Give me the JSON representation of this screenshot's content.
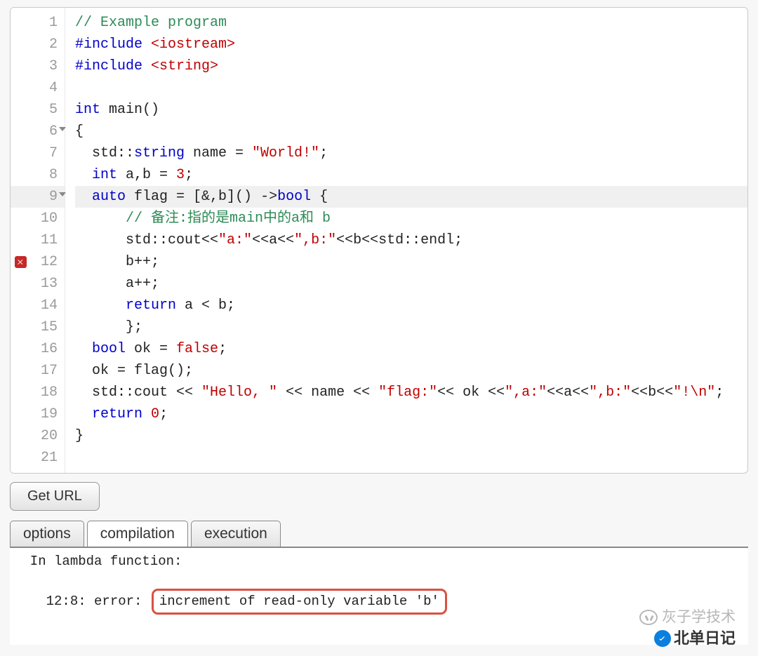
{
  "editor": {
    "error_line": 12,
    "fold_lines": [
      6,
      9
    ],
    "highlight_line": 9,
    "lines": [
      {
        "n": 1,
        "tokens": [
          {
            "t": "// Example program",
            "c": "comment"
          }
        ]
      },
      {
        "n": 2,
        "tokens": [
          {
            "t": "#include ",
            "c": "pp"
          },
          {
            "t": "<iostream>",
            "c": "inc"
          }
        ]
      },
      {
        "n": 3,
        "tokens": [
          {
            "t": "#include ",
            "c": "pp"
          },
          {
            "t": "<string>",
            "c": "inc"
          }
        ]
      },
      {
        "n": 4,
        "tokens": []
      },
      {
        "n": 5,
        "tokens": [
          {
            "t": "int",
            "c": "kwtype"
          },
          {
            "t": " main()",
            "c": "default"
          }
        ]
      },
      {
        "n": 6,
        "tokens": [
          {
            "t": "{",
            "c": "default"
          }
        ]
      },
      {
        "n": 7,
        "tokens": [
          {
            "t": "  std::",
            "c": "default"
          },
          {
            "t": "string",
            "c": "kwtype"
          },
          {
            "t": " name = ",
            "c": "default"
          },
          {
            "t": "\"World!\"",
            "c": "str"
          },
          {
            "t": ";",
            "c": "default"
          }
        ]
      },
      {
        "n": 8,
        "tokens": [
          {
            "t": "  ",
            "c": "default"
          },
          {
            "t": "int",
            "c": "kwtype"
          },
          {
            "t": " a,b = ",
            "c": "default"
          },
          {
            "t": "3",
            "c": "num"
          },
          {
            "t": ";",
            "c": "default"
          }
        ]
      },
      {
        "n": 9,
        "tokens": [
          {
            "t": "  ",
            "c": "default"
          },
          {
            "t": "auto",
            "c": "kwtype"
          },
          {
            "t": " flag = [&,b]() ->",
            "c": "default"
          },
          {
            "t": "bool",
            "c": "kwtype"
          },
          {
            "t": " {",
            "c": "default"
          }
        ]
      },
      {
        "n": 10,
        "tokens": [
          {
            "t": "      // 备注:指的是main中的a和 b",
            "c": "comment"
          }
        ]
      },
      {
        "n": 11,
        "tokens": [
          {
            "t": "      std::cout<<",
            "c": "default"
          },
          {
            "t": "\"a:\"",
            "c": "str"
          },
          {
            "t": "<<a<<",
            "c": "default"
          },
          {
            "t": "\",b:\"",
            "c": "str"
          },
          {
            "t": "<<b<<std::endl;",
            "c": "default"
          }
        ]
      },
      {
        "n": 12,
        "tokens": [
          {
            "t": "      b++;",
            "c": "default"
          }
        ]
      },
      {
        "n": 13,
        "tokens": [
          {
            "t": "      a++;",
            "c": "default"
          }
        ]
      },
      {
        "n": 14,
        "tokens": [
          {
            "t": "      ",
            "c": "default"
          },
          {
            "t": "return",
            "c": "kw"
          },
          {
            "t": " a < b;",
            "c": "default"
          }
        ]
      },
      {
        "n": 15,
        "tokens": [
          {
            "t": "      };",
            "c": "default"
          }
        ]
      },
      {
        "n": 16,
        "tokens": [
          {
            "t": "  ",
            "c": "default"
          },
          {
            "t": "bool",
            "c": "kwtype"
          },
          {
            "t": " ok = ",
            "c": "default"
          },
          {
            "t": "false",
            "c": "bool"
          },
          {
            "t": ";",
            "c": "default"
          }
        ]
      },
      {
        "n": 17,
        "tokens": [
          {
            "t": "  ok = flag();",
            "c": "default"
          }
        ]
      },
      {
        "n": 18,
        "tokens": [
          {
            "t": "  std::cout << ",
            "c": "default"
          },
          {
            "t": "\"Hello, \"",
            "c": "str"
          },
          {
            "t": " << name << ",
            "c": "default"
          },
          {
            "t": "\"flag:\"",
            "c": "str"
          },
          {
            "t": "<< ok <<",
            "c": "default"
          },
          {
            "t": "\",a:\"",
            "c": "str"
          },
          {
            "t": "<<a<<",
            "c": "default"
          },
          {
            "t": "\",b:\"",
            "c": "str"
          },
          {
            "t": "<<b<<",
            "c": "default"
          },
          {
            "t": "\"!\\n\"",
            "c": "str"
          },
          {
            "t": ";",
            "c": "default"
          }
        ]
      },
      {
        "n": 19,
        "tokens": [
          {
            "t": "  ",
            "c": "default"
          },
          {
            "t": "return",
            "c": "kw"
          },
          {
            "t": " ",
            "c": "default"
          },
          {
            "t": "0",
            "c": "num"
          },
          {
            "t": ";",
            "c": "default"
          }
        ]
      },
      {
        "n": 20,
        "tokens": [
          {
            "t": "}",
            "c": "default"
          }
        ]
      },
      {
        "n": 21,
        "tokens": []
      }
    ]
  },
  "buttons": {
    "get_url": "Get URL"
  },
  "tabs": {
    "items": [
      "options",
      "compilation",
      "execution"
    ],
    "active_index": 1
  },
  "output": {
    "line1": "  In lambda function:",
    "line2_prefix": "12:8: error: ",
    "line2_boxed": "increment of read-only variable 'b'"
  },
  "watermark": {
    "top": "灰子学技术",
    "bottom": "北单日记"
  }
}
